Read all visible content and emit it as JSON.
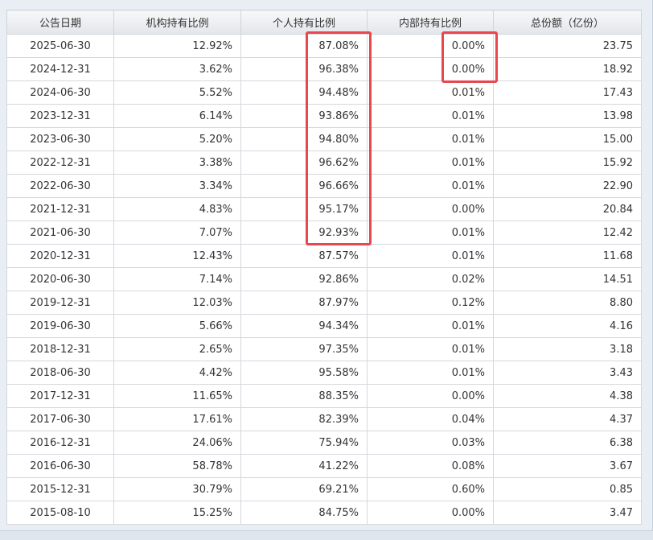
{
  "highlight_color": "#e8474f",
  "columns": [
    "公告日期",
    "机构持有比例",
    "个人持有比例",
    "内部持有比例",
    "总份额（亿份）"
  ],
  "rows": [
    [
      "2025-06-30",
      "12.92%",
      "87.08%",
      "0.00%",
      "23.75"
    ],
    [
      "2024-12-31",
      "3.62%",
      "96.38%",
      "0.00%",
      "18.92"
    ],
    [
      "2024-06-30",
      "5.52%",
      "94.48%",
      "0.01%",
      "17.43"
    ],
    [
      "2023-12-31",
      "6.14%",
      "93.86%",
      "0.01%",
      "13.98"
    ],
    [
      "2023-06-30",
      "5.20%",
      "94.80%",
      "0.01%",
      "15.00"
    ],
    [
      "2022-12-31",
      "3.38%",
      "96.62%",
      "0.01%",
      "15.92"
    ],
    [
      "2022-06-30",
      "3.34%",
      "96.66%",
      "0.01%",
      "22.90"
    ],
    [
      "2021-12-31",
      "4.83%",
      "95.17%",
      "0.00%",
      "20.84"
    ],
    [
      "2021-06-30",
      "7.07%",
      "92.93%",
      "0.01%",
      "12.42"
    ],
    [
      "2020-12-31",
      "12.43%",
      "87.57%",
      "0.01%",
      "11.68"
    ],
    [
      "2020-06-30",
      "7.14%",
      "92.86%",
      "0.02%",
      "14.51"
    ],
    [
      "2019-12-31",
      "12.03%",
      "87.97%",
      "0.12%",
      "8.80"
    ],
    [
      "2019-06-30",
      "5.66%",
      "94.34%",
      "0.01%",
      "4.16"
    ],
    [
      "2018-12-31",
      "2.65%",
      "97.35%",
      "0.01%",
      "3.18"
    ],
    [
      "2018-06-30",
      "4.42%",
      "95.58%",
      "0.01%",
      "3.43"
    ],
    [
      "2017-12-31",
      "11.65%",
      "88.35%",
      "0.00%",
      "4.38"
    ],
    [
      "2017-06-30",
      "17.61%",
      "82.39%",
      "0.04%",
      "4.37"
    ],
    [
      "2016-12-31",
      "24.06%",
      "75.94%",
      "0.03%",
      "6.38"
    ],
    [
      "2016-06-30",
      "58.78%",
      "41.22%",
      "0.08%",
      "3.67"
    ],
    [
      "2015-12-31",
      "30.79%",
      "69.21%",
      "0.60%",
      "0.85"
    ],
    [
      "2015-08-10",
      "15.25%",
      "84.75%",
      "0.00%",
      "3.47"
    ]
  ]
}
